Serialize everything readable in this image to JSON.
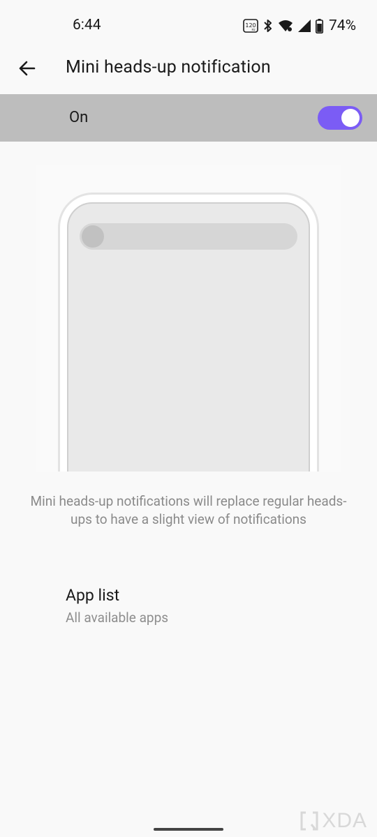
{
  "status_bar": {
    "time": "6:44",
    "battery_percent": "74%",
    "icons": [
      "refresh-rate-120-icon",
      "bluetooth-icon",
      "wifi-icon",
      "cell-signal-icon",
      "battery-icon"
    ]
  },
  "app_bar": {
    "title": "Mini heads-up notification"
  },
  "toggle": {
    "label": "On",
    "state": "on",
    "accent_color": "#7b5cf5"
  },
  "description": "Mini heads-up notifications will replace regular heads-ups to have a slight view of notifications",
  "app_list": {
    "title": "App list",
    "subtitle": "All available apps"
  },
  "watermark": {
    "text": "XDA"
  }
}
